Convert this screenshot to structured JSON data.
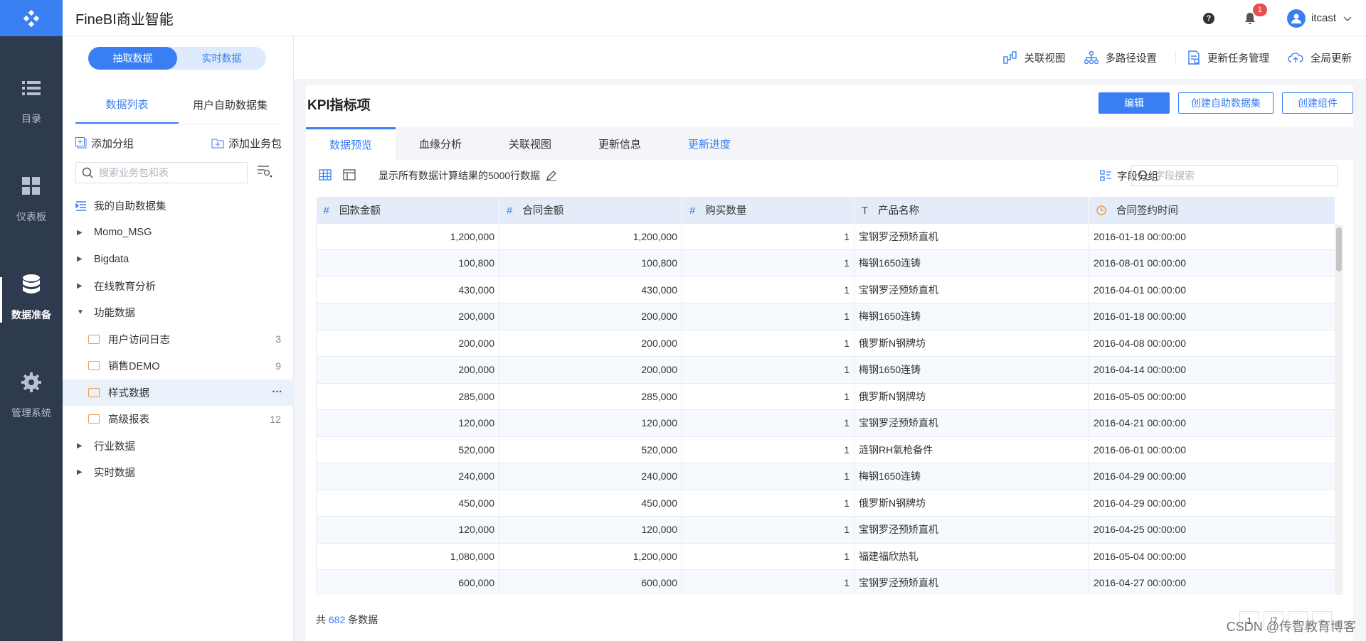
{
  "app": {
    "title": "FineBI商业智能",
    "notifications": "1",
    "username": "itcast",
    "help": "?"
  },
  "nav": [
    {
      "label": "目录",
      "icon": "list-icon"
    },
    {
      "label": "仪表板",
      "icon": "dashboard-icon"
    },
    {
      "label": "数据准备",
      "icon": "database-icon",
      "active": true
    },
    {
      "label": "管理系统",
      "icon": "gear-icon"
    }
  ],
  "left": {
    "mode": [
      "抽取数据",
      "实时数据"
    ],
    "tabs": [
      "数据列表",
      "用户自助数据集"
    ],
    "add_group": "添加分组",
    "add_package": "添加业务包",
    "search_placeholder": "搜索业务包和表",
    "tree": [
      {
        "label": "我的自助数据集",
        "type": "self"
      },
      {
        "label": "Momo_MSG",
        "type": "collapsed"
      },
      {
        "label": "Bigdata",
        "type": "collapsed"
      },
      {
        "label": "在线教育分析",
        "type": "collapsed"
      },
      {
        "label": "功能数据",
        "type": "expanded"
      },
      {
        "label": "用户访问日志",
        "type": "folder",
        "count": "3"
      },
      {
        "label": "销售DEMO",
        "type": "folder",
        "count": "9"
      },
      {
        "label": "样式数据",
        "type": "folder",
        "selected": true,
        "more": "···"
      },
      {
        "label": "高级报表",
        "type": "folder",
        "count": "12"
      },
      {
        "label": "行业数据",
        "type": "collapsed"
      },
      {
        "label": "实时数据",
        "type": "collapsed"
      }
    ]
  },
  "toolbar": [
    "关联视图",
    "多路径设置",
    "更新任务管理",
    "全局更新"
  ],
  "main": {
    "title": "KPI指标项",
    "buttons": {
      "edit": "编辑",
      "create_dataset": "创建自助数据集",
      "create_component": "创建组件"
    },
    "tabs": [
      "数据预览",
      "血缘分析",
      "关联视图",
      "更新信息",
      "更新进度"
    ],
    "desc": "显示所有数据计算结果的5000行数据",
    "field_group": "字段分组",
    "field_search_placeholder": "字段搜索",
    "columns": [
      {
        "label": "回款金额",
        "type": "#"
      },
      {
        "label": "合同金额",
        "type": "#"
      },
      {
        "label": "购买数量",
        "type": "#"
      },
      {
        "label": "产品名称",
        "type": "T"
      },
      {
        "label": "合同签约时间",
        "type": "clock"
      }
    ],
    "rows": [
      [
        "1,200,000",
        "1,200,000",
        "1",
        "宝钢罗泾预矫直机",
        "2016-01-18 00:00:00"
      ],
      [
        "100,800",
        "100,800",
        "1",
        "梅钢1650连铸",
        "2016-08-01 00:00:00"
      ],
      [
        "430,000",
        "430,000",
        "1",
        "宝钢罗泾预矫直机",
        "2016-04-01 00:00:00"
      ],
      [
        "200,000",
        "200,000",
        "1",
        "梅钢1650连铸",
        "2016-01-18 00:00:00"
      ],
      [
        "200,000",
        "200,000",
        "1",
        "俄罗斯N钢牌坊",
        "2016-04-08 00:00:00"
      ],
      [
        "200,000",
        "200,000",
        "1",
        "梅钢1650连铸",
        "2016-04-14 00:00:00"
      ],
      [
        "285,000",
        "285,000",
        "1",
        "俄罗斯N钢牌坊",
        "2016-05-05 00:00:00"
      ],
      [
        "120,000",
        "120,000",
        "1",
        "宝钢罗泾预矫直机",
        "2016-04-21 00:00:00"
      ],
      [
        "520,000",
        "520,000",
        "1",
        "涟钢RH氧枪备件",
        "2016-06-01 00:00:00"
      ],
      [
        "240,000",
        "240,000",
        "1",
        "梅钢1650连铸",
        "2016-04-29 00:00:00"
      ],
      [
        "450,000",
        "450,000",
        "1",
        "俄罗斯N钢牌坊",
        "2016-04-29 00:00:00"
      ],
      [
        "120,000",
        "120,000",
        "1",
        "宝钢罗泾预矫直机",
        "2016-04-25 00:00:00"
      ],
      [
        "1,080,000",
        "1,200,000",
        "1",
        "福建福欣热轧",
        "2016-05-04 00:00:00"
      ],
      [
        "600,000",
        "600,000",
        "1",
        "宝钢罗泾预矫直机",
        "2016-04-27 00:00:00"
      ]
    ],
    "footer": {
      "prefix": "共",
      "count": "682",
      "suffix": "条数据"
    },
    "pager": [
      "1",
      "/7",
      "‹",
      "›"
    ]
  },
  "watermark": "CSDN @传智教育博客",
  "colors": {
    "accent": "#3a7ff2",
    "nav_bg": "#2e3a4d",
    "header_bg": "#e4ecf9"
  }
}
